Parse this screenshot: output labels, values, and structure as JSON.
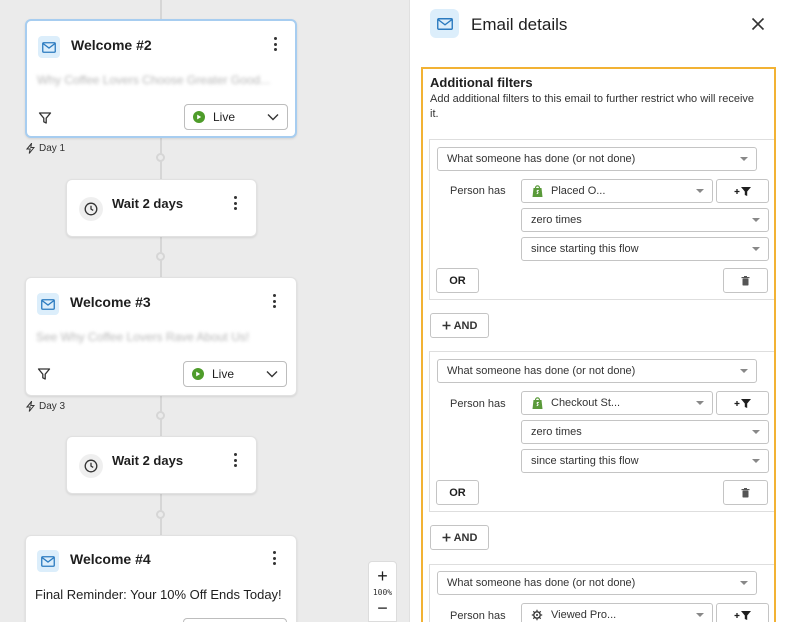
{
  "flow": {
    "steps": [
      {
        "type": "email",
        "title": "Welcome #2",
        "preview": "Why Coffee Lovers Choose Greater Good...",
        "preview_blurred": true,
        "status": "Live",
        "day_label": "Day 1"
      },
      {
        "type": "wait",
        "title": "Wait 2 days"
      },
      {
        "type": "email",
        "title": "Welcome #3",
        "preview": "See Why Coffee Lovers Rave About Us!",
        "preview_blurred": true,
        "status": "Live",
        "day_label": "Day 3"
      },
      {
        "type": "wait",
        "title": "Wait 2 days"
      },
      {
        "type": "email",
        "title": "Welcome #4",
        "preview": "Final Reminder: Your 10% Off Ends Today!",
        "preview_blurred": false
      }
    ],
    "zoom": {
      "plus": "+",
      "level": "100%",
      "minus": "−"
    }
  },
  "panel": {
    "title": "Email details",
    "filters": {
      "heading": "Additional filters",
      "description": "Add additional filters to this email to further restrict who will receive it.",
      "person_has_label": "Person has",
      "or_label": "OR",
      "and_label": "AND",
      "groups": [
        {
          "condition": "What someone has done (or not done)",
          "metric": "Placed O...",
          "metric_icon": "shopify-icon",
          "frequency": "zero times",
          "timeframe": "since starting this flow"
        },
        {
          "condition": "What someone has done (or not done)",
          "metric": "Checkout St...",
          "metric_icon": "shopify-icon",
          "frequency": "zero times",
          "timeframe": "since starting this flow"
        },
        {
          "condition": "What someone has done (or not done)",
          "metric": "Viewed Pro...",
          "metric_icon": "gear-icon"
        }
      ]
    }
  },
  "colors": {
    "accent_outline": "#f2b234",
    "selected_card_border": "#a7cdf0",
    "live_green": "#4e9c2a",
    "mail_badge_bg": "#dceefb"
  }
}
